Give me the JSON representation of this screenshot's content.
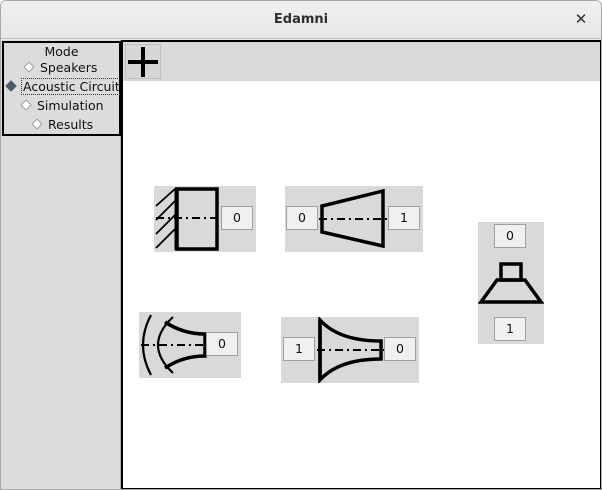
{
  "window": {
    "title": "Edamni"
  },
  "mode": {
    "title": "Mode",
    "options": [
      {
        "label": "Speakers",
        "selected": false
      },
      {
        "label": "Acoustic Circuit",
        "selected": true
      },
      {
        "label": "Simulation",
        "selected": false
      },
      {
        "label": "Results",
        "selected": false
      }
    ]
  },
  "toolbar": {
    "add_icon": "plus-icon"
  },
  "components": {
    "closed_box": {
      "icon": "closed-box-icon",
      "ports": [
        "0"
      ]
    },
    "conical_horn": {
      "icon": "conical-horn-icon",
      "ports": [
        "0",
        "1"
      ]
    },
    "speaker": {
      "icon": "speaker-icon",
      "ports": [
        "0",
        "1"
      ]
    },
    "radiation": {
      "icon": "radiation-icon",
      "ports": [
        "0"
      ]
    },
    "exponential_horn": {
      "icon": "exponential-horn-icon",
      "ports": [
        "1",
        "0"
      ]
    }
  }
}
